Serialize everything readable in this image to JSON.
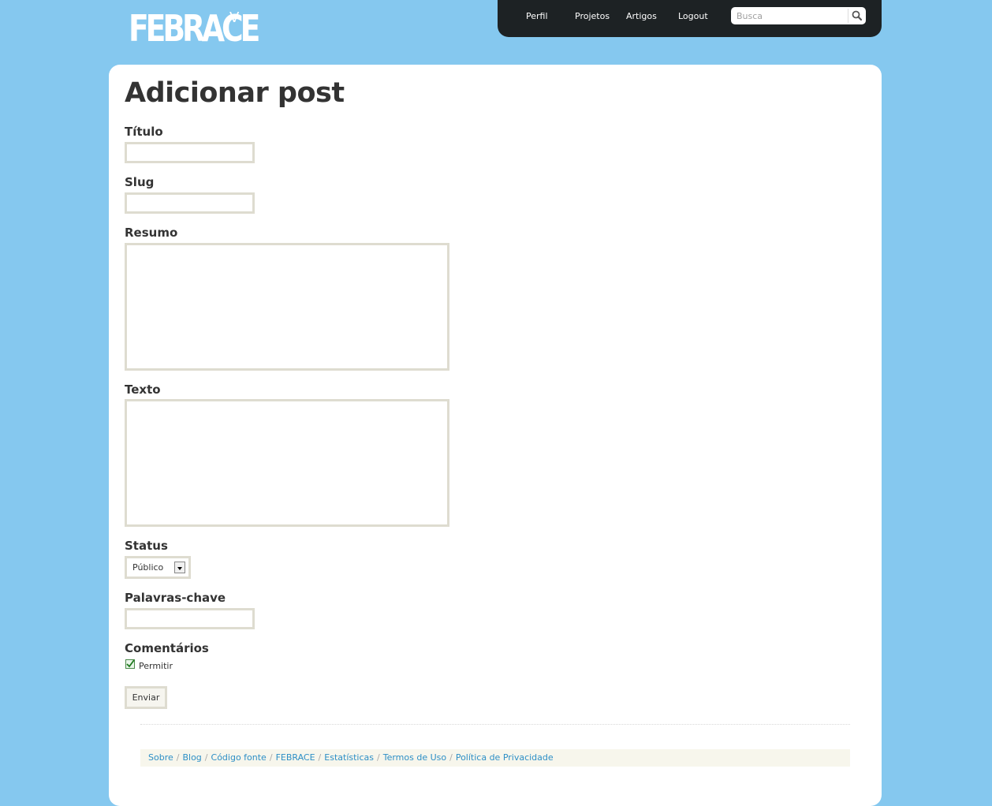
{
  "logo": {
    "main": "FEBRACE",
    "sup": "V"
  },
  "nav": {
    "profile": "Perfil",
    "projects": "Projetos",
    "articles": "Artigos",
    "logout": "Logout"
  },
  "search": {
    "placeholder": "Busca",
    "icon": "search-icon"
  },
  "form": {
    "heading": "Adicionar post",
    "title_label": "Título",
    "slug_label": "Slug",
    "summary_label": "Resumo",
    "text_label": "Texto",
    "status_label": "Status",
    "status_value": "Público",
    "keywords_label": "Palavras-chave",
    "comments_label": "Comentários",
    "allow_label": "Permitir",
    "allow_checked": true,
    "submit_label": "Enviar"
  },
  "footer": {
    "links": [
      "Sobre",
      "Blog",
      "Código fonte",
      "FEBRACE",
      "Estatísticas",
      "Termos de Uso",
      "Política de Privacidade"
    ],
    "separator": "/"
  },
  "colors": {
    "background": "#85c8ef",
    "topbar": "#1d2224",
    "field_border": "#dedcd0",
    "link": "#2d8fc6",
    "heading": "#333333"
  }
}
